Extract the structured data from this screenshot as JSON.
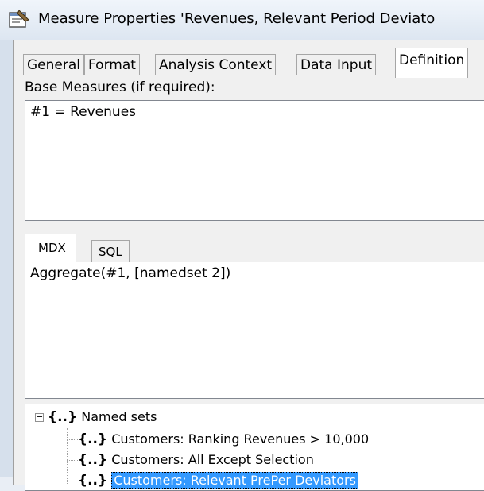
{
  "window": {
    "title": "Measure Properties 'Revenues, Relevant Period Deviato"
  },
  "tabs": [
    {
      "label": "General",
      "active": false
    },
    {
      "label": "Format",
      "active": false
    },
    {
      "label": "Analysis Context",
      "active": false
    },
    {
      "label": "Data Input",
      "active": false
    },
    {
      "label": "Definition",
      "active": true
    }
  ],
  "definition": {
    "base_measures_label": "Base Measures (if required):",
    "base_measures_value": "#1 = Revenues",
    "subtabs": [
      {
        "label": "MDX",
        "active": true
      },
      {
        "label": "SQL",
        "active": false
      }
    ],
    "expression": "Aggregate(#1, [namedset 2])",
    "tree": {
      "root": {
        "label": "Named sets",
        "expander": "−",
        "icon": "named-set-icon",
        "braces": "{..}"
      },
      "children": [
        {
          "label": "Customers: Ranking Revenues > 10,000",
          "selected": false,
          "braces": "{..}"
        },
        {
          "label": "Customers: All Except Selection",
          "selected": false,
          "braces": "{..}"
        },
        {
          "label": "Customers: Relevant PrePer Deviators",
          "selected": true,
          "braces": "{..}"
        }
      ]
    }
  },
  "colors": {
    "selection": "#3399ff",
    "dialog_bg": "#f0f0f0",
    "border": "#828790"
  }
}
